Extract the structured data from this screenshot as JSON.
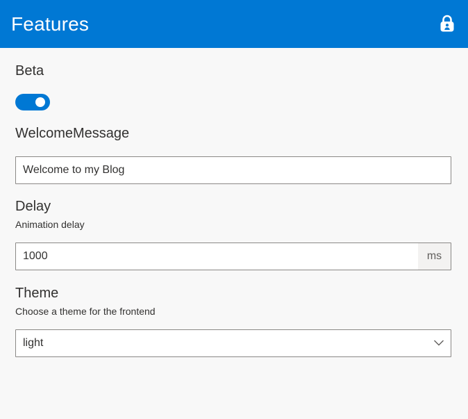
{
  "header": {
    "title": "Features",
    "lock_icon": "lock-icon",
    "background_color": "#0078d4"
  },
  "fields": {
    "beta": {
      "label": "Beta",
      "toggle_on": true
    },
    "welcome_message": {
      "label": "WelcomeMessage",
      "value": "Welcome to my Blog"
    },
    "delay": {
      "label": "Delay",
      "description": "Animation delay",
      "value": "1000",
      "suffix": "ms"
    },
    "theme": {
      "label": "Theme",
      "description": "Choose a theme for the frontend",
      "selected": "light",
      "icon": "chevron-down-icon"
    }
  }
}
